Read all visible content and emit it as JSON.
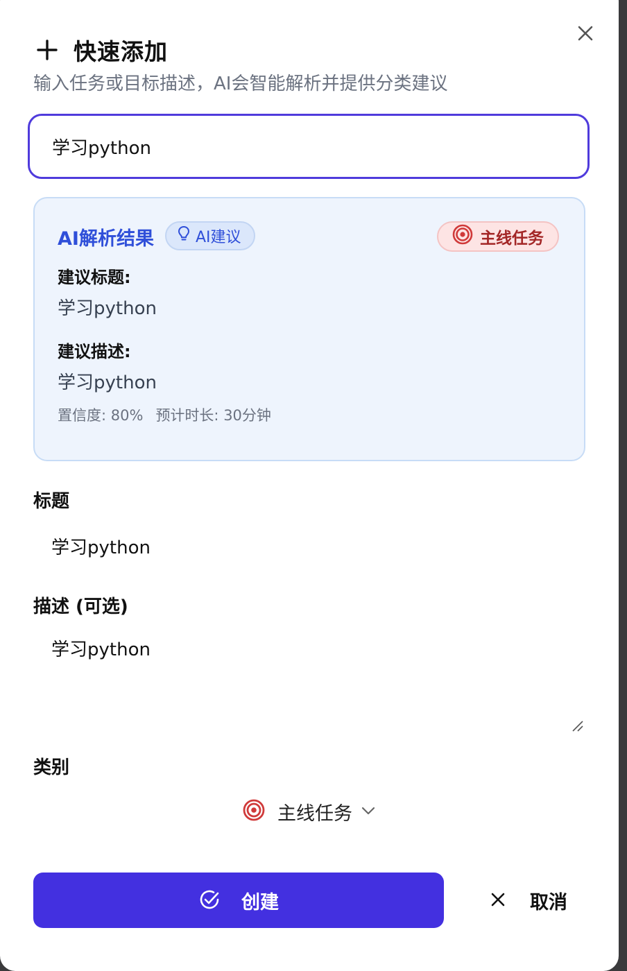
{
  "dialog": {
    "title": "快速添加",
    "subtitle": "输入任务或目标描述，AI会智能解析并提供分类建议"
  },
  "input": {
    "value": "学习python",
    "placeholder": ""
  },
  "ai_result": {
    "heading": "AI解析结果",
    "badge_label": "AI建议",
    "category_label": "主线任务",
    "suggested_title_label": "建议标题:",
    "suggested_title_value": "学习python",
    "suggested_desc_label": "建议描述:",
    "suggested_desc_value": "学习python",
    "confidence": "置信度: 80%",
    "estimated_duration": "预计时长: 30分钟"
  },
  "form": {
    "title_label": "标题",
    "title_value": "学习python",
    "desc_label": "描述 (可选)",
    "desc_value": "学习python",
    "category_label": "类别",
    "category_value": "主线任务"
  },
  "actions": {
    "create_label": "创建",
    "cancel_label": "取消"
  },
  "colors": {
    "primary": "#4330e0",
    "ai_accent": "#2f4fd9",
    "main_task_red": "#d03a3a"
  },
  "icons": {
    "add": "plus-icon",
    "close": "close-icon",
    "ai_hint": "lightbulb-icon",
    "main_task": "target-icon",
    "dropdown": "chevron-down-icon",
    "confirm": "check-circle-icon",
    "cancel": "x-icon"
  }
}
